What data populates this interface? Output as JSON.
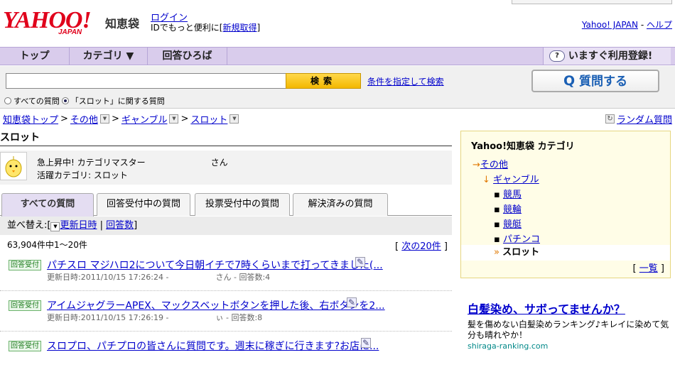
{
  "header": {
    "logo_text": "YAHOO!",
    "logo_sub": "JAPAN",
    "service_name": "知恵袋",
    "login_link": "ログイン",
    "login_sub_prefix": "IDでもっと便利に[",
    "register_link": "新規取得",
    "login_sub_suffix": "]",
    "yahoo_japan_link": "Yahoo! JAPAN",
    "sep": "-",
    "help_link": "ヘルプ"
  },
  "nav": {
    "items": [
      "トップ",
      "カテゴリ ▼",
      "回答ひろば"
    ],
    "register_now": "いますぐ利用登録!"
  },
  "search": {
    "placeholder": "",
    "button": "検索",
    "advanced_link": "条件を指定して検索",
    "scope_all": "すべての質問",
    "scope_cat": "「スロット」に関する質問",
    "ask_button": "質問する"
  },
  "breadcrumb": {
    "items": [
      "知恵袋トップ",
      "その他",
      "ギャンブル",
      "スロット"
    ],
    "random_link": "ランダム質問"
  },
  "page_title": "スロット",
  "master": {
    "line1_label": "急上昇中! カテゴリマスター",
    "line1_suffix": "さん",
    "line2": "活躍カテゴリ: スロット"
  },
  "tabs": [
    "すべての質問",
    "回答受付中の質問",
    "投票受付中の質問",
    "解決済みの質問"
  ],
  "sort": {
    "prefix": "並べ替え:[",
    "updated_link": "更新日時",
    "sep": "|",
    "answers_link": "回答数",
    "suffix": "]"
  },
  "results": {
    "count_text": "63,904件中1〜20件",
    "next_prefix": "[",
    "next_link": "次の20件",
    "next_suffix": "]"
  },
  "questions": [
    {
      "badge": "回答受付",
      "title": "パチスロ マジハロ2について今日朝イチで7時くらいまで打ってきました(...",
      "updated": "更新日時:2011/10/15 17:26:24 -",
      "answers": "さん - 回答数:4"
    },
    {
      "badge": "回答受付",
      "title": "アイムジャグラーAPEX、マックスベットボタンを押した後、右ボタンを2...",
      "updated": "更新日時:2011/10/15 17:26:19 -",
      "answers": "ぃ - 回答数:8"
    },
    {
      "badge": "回答受付",
      "title": "スロプロ、パチプロの皆さんに質問です。週末に稼ぎに行きます?お店に...",
      "updated": "",
      "answers": ""
    }
  ],
  "category_box": {
    "title": "Yahoo!知恵袋 カテゴリ",
    "items": [
      "その他",
      "ギャンブル",
      "競馬",
      "競輪",
      "競艇",
      "パチンコ",
      "スロット"
    ],
    "list_prefix": "[",
    "list_link": "一覧",
    "list_suffix": "]"
  },
  "ad": {
    "headline": "白髪染め、サボってませんか？",
    "text": "髪を傷めない白髪染めランキング♪キレイに染めて気分も晴れやか！",
    "url": "shiraga-ranking.com"
  },
  "colors": {
    "accent": "#d9ccec",
    "logo_red": "#e0001b",
    "link": "#0000cc",
    "search_button": "#f3b800"
  }
}
